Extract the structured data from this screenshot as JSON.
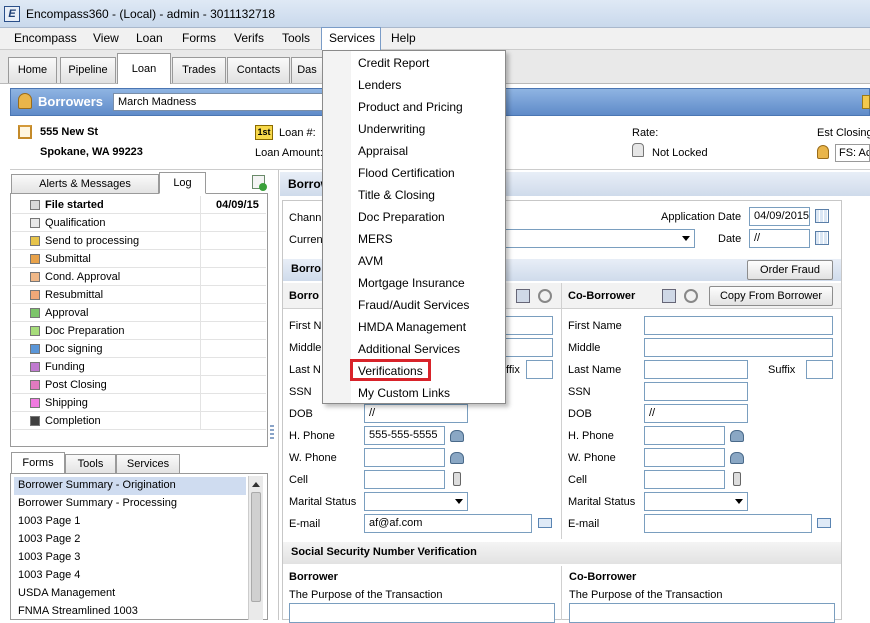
{
  "window": {
    "title": "Encompass360 - (Local) - admin - 3011132718",
    "app_icon": "E"
  },
  "menubar": [
    "Encompass",
    "View",
    "Loan",
    "Forms",
    "Verifs",
    "Tools",
    "Services",
    "Help"
  ],
  "tabs": [
    "Home",
    "Pipeline",
    "Loan",
    "Trades",
    "Contacts",
    "Das"
  ],
  "active_tab": "Loan",
  "borrowers_bar": {
    "title": "Borrowers",
    "loan_name": "March Madness"
  },
  "loan_info": {
    "address_line1": "555 New St",
    "address_line2": "Spokane, WA 99223",
    "lien_badge": "1st",
    "loan_number_label": "Loan #:",
    "loan_amount_label": "Loan Amount:",
    "rate_label": "Rate:",
    "rate_lock_status": "Not Locked",
    "est_closing_label": "Est Closing",
    "est_closing_value": "FS: Ac"
  },
  "left_panel": {
    "tabs": [
      "Alerts & Messages",
      "Log"
    ],
    "active_tab": "Log",
    "log_items": [
      {
        "label": "File started",
        "date": "04/09/15",
        "color": "#d8d8d8",
        "bold": true
      },
      {
        "label": "Qualification",
        "date": "",
        "color": "#e8e8e8",
        "bold": false
      },
      {
        "label": "Send to processing",
        "date": "",
        "color": "#e6c34a",
        "bold": false
      },
      {
        "label": "Submittal",
        "date": "",
        "color": "#e8a24a",
        "bold": false
      },
      {
        "label": "Cond. Approval",
        "date": "",
        "color": "#f0b888",
        "bold": false
      },
      {
        "label": "Resubmittal",
        "date": "",
        "color": "#f0a878",
        "bold": false
      },
      {
        "label": "Approval",
        "date": "",
        "color": "#7cc46a",
        "bold": false
      },
      {
        "label": "Doc Preparation",
        "date": "",
        "color": "#a6dc7a",
        "bold": false
      },
      {
        "label": "Doc signing",
        "date": "",
        "color": "#5a96d8",
        "bold": false
      },
      {
        "label": "Funding",
        "date": "",
        "color": "#c07ad0",
        "bold": false
      },
      {
        "label": "Post Closing",
        "date": "",
        "color": "#e07ac0",
        "bold": false
      },
      {
        "label": "Shipping",
        "date": "",
        "color": "#f07ae0",
        "bold": false
      },
      {
        "label": "Completion",
        "date": "",
        "color": "#404040",
        "bold": false
      }
    ]
  },
  "forms_panel": {
    "tabs": [
      "Forms",
      "Tools",
      "Services"
    ],
    "active_tab": "Forms",
    "items": [
      "Borrower Summary - Origination",
      "Borrower Summary - Processing",
      "1003 Page 1",
      "1003 Page 2",
      "1003 Page 3",
      "1003 Page 4",
      "USDA Management",
      "FNMA Streamlined 1003"
    ],
    "selected_index": 0
  },
  "main": {
    "header": "Borrow",
    "channel_label": "Chann",
    "current_label": "Curren",
    "application_date_label": "Application Date",
    "application_date_value": "04/09/2015",
    "date_label": "Date",
    "date_value": "//",
    "section_borrower_short": "Borro",
    "order_fraud_button": "Order Fraud",
    "borrower_col": {
      "title": "Borro",
      "first_name_label": "First N",
      "middle_label": "Middle",
      "last_name_label": "Last N",
      "suffix_label": "ffix",
      "ssn_label": "SSN",
      "dob_label": "DOB",
      "dob_value": "//",
      "home_phone_label": "H. Phone",
      "home_phone_value": "555-555-5555",
      "work_phone_label": "W. Phone",
      "cell_label": "Cell",
      "marital_label": "Marital Status",
      "email_label": "E-mail",
      "email_value": "af@af.com"
    },
    "coborrower_col": {
      "title": "Co-Borrower",
      "copy_button": "Copy From Borrower",
      "first_name_label": "First Name",
      "middle_label": "Middle",
      "last_name_label": "Last Name",
      "suffix_label": "Suffix",
      "ssn_label": "SSN",
      "dob_label": "DOB",
      "dob_value": "//",
      "home_phone_label": "H. Phone",
      "work_phone_label": "W. Phone",
      "cell_label": "Cell",
      "marital_label": "Marital Status",
      "email_label": "E-mail"
    },
    "ssn_section": {
      "title": "Social Security Number Verification",
      "borrower_title": "Borrower",
      "coborrower_title": "Co-Borrower",
      "purpose_label": "The Purpose of the Transaction"
    }
  },
  "services_menu": {
    "items": [
      "Credit Report",
      "Lenders",
      "Product and Pricing",
      "Underwriting",
      "Appraisal",
      "Flood Certification",
      "Title & Closing",
      "Doc Preparation",
      "MERS",
      "AVM",
      "Mortgage Insurance",
      "Fraud/Audit Services",
      "HMDA Management",
      "Additional Services",
      "Verifications",
      "My Custom Links"
    ],
    "highlighted_item": "Verifications",
    "highlight_color": "#d8232a"
  }
}
